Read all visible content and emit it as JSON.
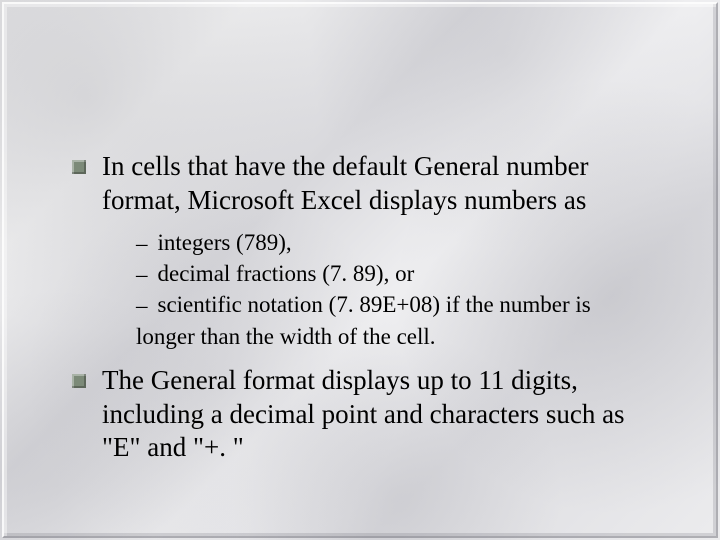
{
  "slide": {
    "items": [
      {
        "level": 1,
        "text": "In cells that have the default General number format, Microsoft Excel displays numbers as"
      },
      {
        "level": 2,
        "text": " integers (789),"
      },
      {
        "level": 2,
        "text": "decimal fractions (7. 89), or"
      },
      {
        "level": 2,
        "text": " scientific notation (7. 89E+08) if the number is"
      },
      {
        "level": "2-cont",
        "text": "longer than the width of the cell."
      },
      {
        "level": 1,
        "text": "The General format displays up to 11 digits, including a decimal point and characters such as \"E\" and \"+. \""
      }
    ]
  }
}
